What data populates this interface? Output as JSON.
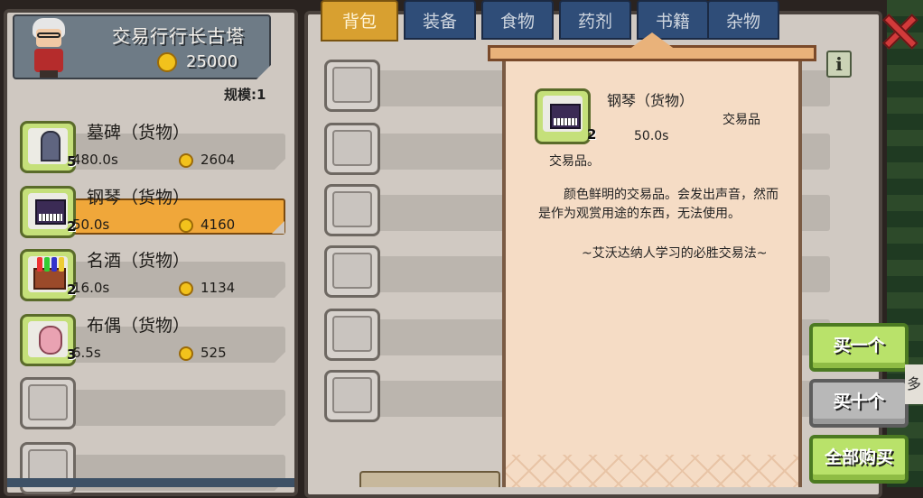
{
  "merchant": {
    "name": "交易行行长古塔",
    "gold": "25000",
    "scale": "规模:1"
  },
  "goods": [
    {
      "name": "墓碑（货物）",
      "qty": "5",
      "time": "480.0s",
      "price": "2604",
      "icon": "tombstone-icon"
    },
    {
      "name": "钢琴（货物）",
      "qty": "2",
      "time": "50.0s",
      "price": "4160",
      "icon": "piano-icon",
      "selected": true
    },
    {
      "name": "名酒（货物）",
      "qty": "2",
      "time": "16.0s",
      "price": "1134",
      "icon": "wine-icon"
    },
    {
      "name": "布偶（货物）",
      "qty": "3",
      "time": "6.5s",
      "price": "525",
      "icon": "doll-icon"
    }
  ],
  "tabs": [
    "背包",
    "装备",
    "食物",
    "药剂",
    "书籍",
    "杂物"
  ],
  "detail": {
    "name": "钢琴（货物）",
    "qty": "2",
    "type": "交易品",
    "time": "50.0s",
    "category": "交易品。",
    "description": "颜色鲜明的交易品。会发出声音，然而是作为观赏用途的东西，无法使用。",
    "quote": "~艾沃达纳人学习的必胜交易法~"
  },
  "buttons": {
    "buy_one": "买一个",
    "buy_ten": "买十个",
    "buy_all": "全部购买",
    "info": "i"
  },
  "side_hint": "多",
  "colors": {
    "selected_row": "#f0a73a",
    "active_tab": "#d8a030",
    "tab": "#2f4d78",
    "buy_green": "#b9e26a",
    "close_red": "#d13a3a"
  }
}
